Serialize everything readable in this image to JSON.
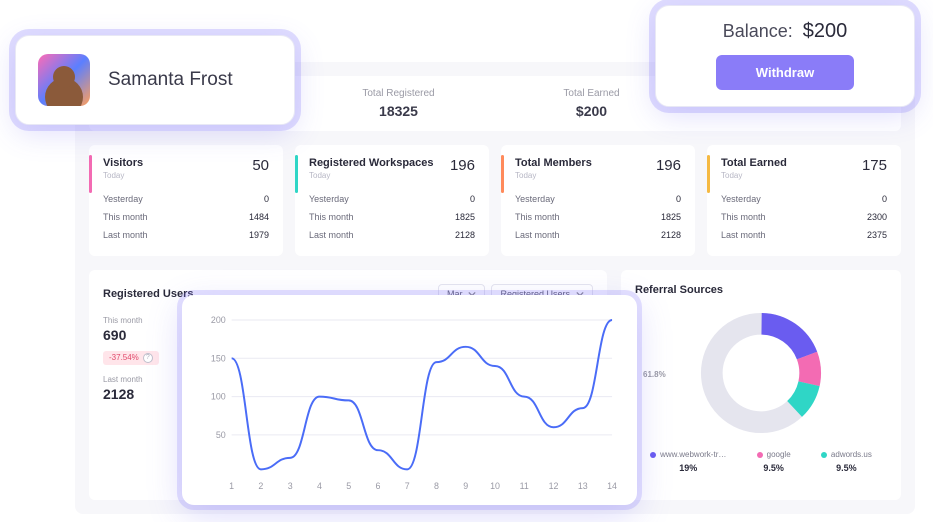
{
  "topbar": {
    "registered": {
      "label": "Total Registered",
      "value": "18325"
    },
    "earned": {
      "label": "Total Earned",
      "value": "$200"
    }
  },
  "balance": {
    "label": "Balance:",
    "value": "$200",
    "withdraw": "Withdraw"
  },
  "profile": {
    "name": "Samanta Frost"
  },
  "stats": [
    {
      "title": "Visitors",
      "sub": "Today",
      "main": "50",
      "rows": [
        [
          "Yesterday",
          "0"
        ],
        [
          "This month",
          "1484"
        ],
        [
          "Last month",
          "1979"
        ]
      ]
    },
    {
      "title": "Registered Workspaces",
      "sub": "Today",
      "main": "196",
      "rows": [
        [
          "Yesterday",
          "0"
        ],
        [
          "This month",
          "1825"
        ],
        [
          "Last month",
          "2128"
        ]
      ]
    },
    {
      "title": "Total Members",
      "sub": "Today",
      "main": "196",
      "rows": [
        [
          "Yesterday",
          "0"
        ],
        [
          "This month",
          "1825"
        ],
        [
          "Last month",
          "2128"
        ]
      ]
    },
    {
      "title": "Total Earned",
      "sub": "Today",
      "main": "175",
      "rows": [
        [
          "Yesterday",
          "0"
        ],
        [
          "This month",
          "2300"
        ],
        [
          "Last month",
          "2375"
        ]
      ]
    }
  ],
  "registered_users": {
    "title": "Registered Users",
    "sel_month": "Mar",
    "sel_metric": "Registered Users",
    "this_month_lbl": "This month",
    "this_month_val": "690",
    "change": "-37.54%",
    "last_month_lbl": "Last month",
    "last_month_val": "2128"
  },
  "referral": {
    "title": "Referral Sources",
    "items": [
      {
        "name": "www.webwork-tr…",
        "pct": "19%",
        "slice": "19.0%",
        "color": "#6a5cf0"
      },
      {
        "name": "google",
        "pct": "9.5%",
        "slice": "9.5%",
        "color": "#f36bb3"
      },
      {
        "name": "adwords.us",
        "pct": "9.5%",
        "slice": "9.5%",
        "color": "#2fd6c6"
      }
    ],
    "other_slice": "61.8%"
  },
  "chart_data": {
    "type": "line",
    "title": "Registered Users",
    "x": [
      1,
      2,
      3,
      4,
      5,
      6,
      7,
      8,
      9,
      10,
      11,
      12,
      13,
      14
    ],
    "values": [
      150,
      5,
      20,
      100,
      95,
      30,
      5,
      145,
      165,
      140,
      100,
      60,
      85,
      200
    ],
    "ylabel": "",
    "xlabel": "",
    "ylim": [
      0,
      200
    ],
    "yticks": [
      50,
      100,
      150,
      200
    ]
  }
}
